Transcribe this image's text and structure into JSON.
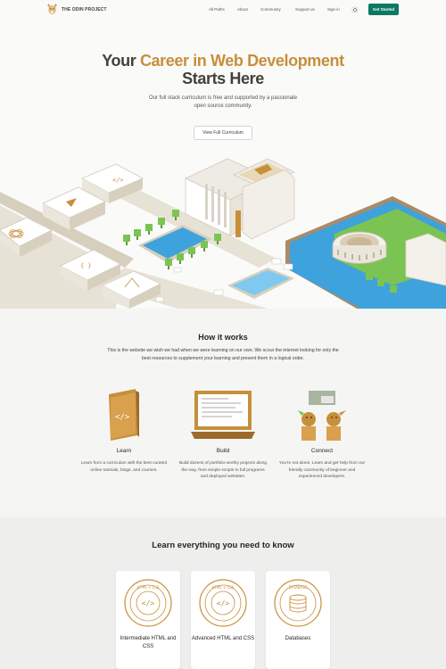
{
  "header": {
    "logo_text": "THE ODIN PROJECT",
    "nav": [
      "All Paths",
      "About",
      "Community",
      "Support us",
      "Sign in"
    ],
    "cta_label": "Get Started"
  },
  "hero": {
    "title_part1": "Your ",
    "title_accent": "Career in Web Development",
    "title_part2": "Starts Here",
    "subtitle": "Our full stack curriculum is free and supported by a passionate open source community.",
    "button_label": "View Full Curriculum"
  },
  "how_it_works": {
    "title": "How it works",
    "description": "This is the website we wish we had when we were learning on our own. We scour the internet looking for only the best resources to supplement your learning and present them in a logical order.",
    "steps": [
      {
        "title": "Learn",
        "description": "Learn from a curriculum with the best curated online tutorials, blogs, and courses."
      },
      {
        "title": "Build",
        "description": "Build dozens of portfolio-worthy projects along the way, from simple scripts to full programs and deployed websites."
      },
      {
        "title": "Connect",
        "description": "You're not alone. Learn and get help from our friendly community of beginner and experienced developers."
      }
    ]
  },
  "learn": {
    "title": "Learn everything you need to know",
    "cards": [
      {
        "title": "Intermediate HTML and CSS",
        "badge_text": "HTML + CSS"
      },
      {
        "title": "Advanced HTML and CSS",
        "badge_text": "HTML + CSS"
      },
      {
        "title": "Databases",
        "badge_text": "DATABASE"
      }
    ]
  },
  "colors": {
    "accent": "#c78f3a",
    "brand_green": "#0d7864",
    "text_dark": "#292524"
  }
}
